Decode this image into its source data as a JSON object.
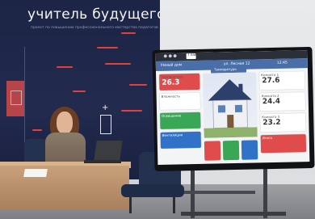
{
  "backdrop": {
    "title": "учитель будущего",
    "subtitle": "проект по повышению профессионального мастерства педагогов"
  },
  "screen": {
    "topbar": {
      "label": "● ● ●",
      "tab": "Главная"
    },
    "header": {
      "left": "Умный дом",
      "mid": "ул. Лесная 12",
      "right": "12:45"
    },
    "house_tag": "Температура",
    "left_cards": [
      {
        "label": "Температура",
        "value": "26.3",
        "color": "#e04b4b"
      },
      {
        "label": "Влажность",
        "value": "",
        "color": "#ffffff"
      },
      {
        "label": "Освещение",
        "value": "",
        "color": "#3aa757"
      },
      {
        "label": "Вентиляция",
        "value": "",
        "color": "#2f72c7"
      }
    ],
    "right_cards": [
      {
        "label": "Комната 1",
        "value": "27.6",
        "color": "#ffffff"
      },
      {
        "label": "Комната 2",
        "value": "24.4",
        "color": "#ffffff"
      },
      {
        "label": "Комната 3",
        "value": "23.2",
        "color": "#ffffff"
      },
      {
        "label": "Итого",
        "value": "",
        "color": "#e04b4b"
      }
    ],
    "bottom_buttons": [
      "#e04b4b",
      "#3aa757",
      "#2f72c7"
    ]
  }
}
